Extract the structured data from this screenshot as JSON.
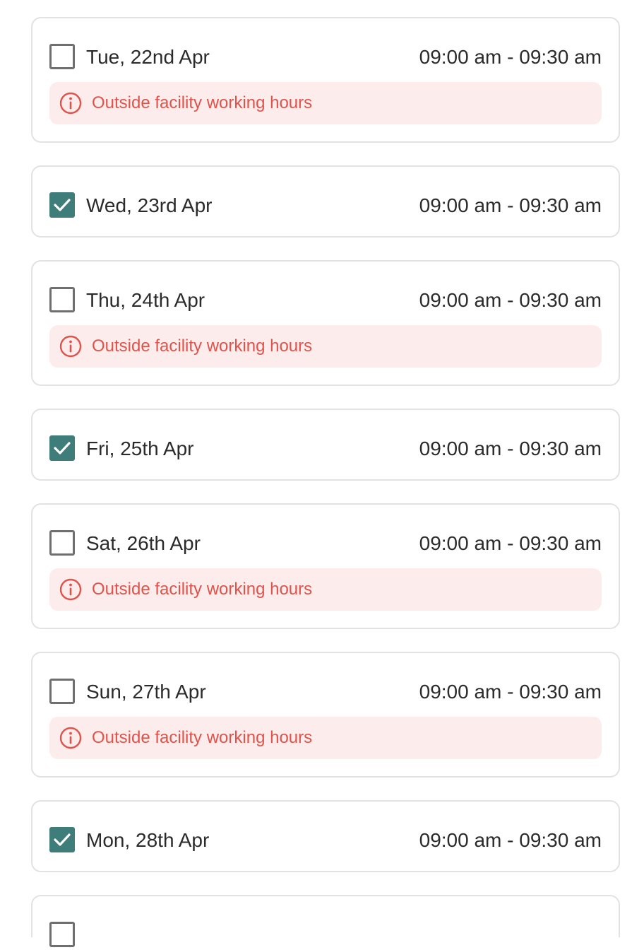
{
  "slots": [
    {
      "date": "Tue, 22nd Apr",
      "time": "09:00 am - 09:30 am",
      "checked": false,
      "warning": "Outside facility working hours"
    },
    {
      "date": "Wed, 23rd Apr",
      "time": "09:00 am - 09:30 am",
      "checked": true,
      "warning": ""
    },
    {
      "date": "Thu, 24th Apr",
      "time": "09:00 am - 09:30 am",
      "checked": false,
      "warning": "Outside facility working hours"
    },
    {
      "date": "Fri, 25th Apr",
      "time": "09:00 am - 09:30 am",
      "checked": true,
      "warning": ""
    },
    {
      "date": "Sat, 26th Apr",
      "time": "09:00 am - 09:30 am",
      "checked": false,
      "warning": "Outside facility working hours"
    },
    {
      "date": "Sun, 27th Apr",
      "time": "09:00 am - 09:30 am",
      "checked": false,
      "warning": "Outside facility working hours"
    },
    {
      "date": "Mon, 28th Apr",
      "time": "09:00 am - 09:30 am",
      "checked": true,
      "warning": ""
    },
    {
      "date": "",
      "time": "",
      "checked": false,
      "warning": ""
    }
  ],
  "colors": {
    "checkbox_checked": "#3f7d7a",
    "warning_text": "#e0534a",
    "warning_background": "#fdecec",
    "card_border": "#e2e2e2"
  },
  "icons": {
    "warning": "info-circle-icon",
    "check": "checkmark-icon"
  }
}
